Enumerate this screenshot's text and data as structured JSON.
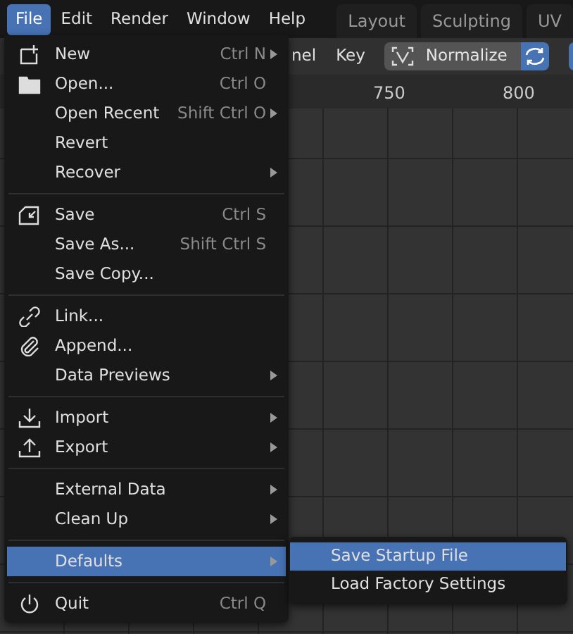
{
  "menubar": [
    {
      "label": "File",
      "selected": true
    },
    {
      "label": "Edit",
      "selected": false
    },
    {
      "label": "Render",
      "selected": false
    },
    {
      "label": "Window",
      "selected": false
    },
    {
      "label": "Help",
      "selected": false
    }
  ],
  "workspace_tabs": [
    {
      "label": "Layout",
      "selected": false
    },
    {
      "label": "Sculpting",
      "selected": false
    },
    {
      "label": "UV",
      "selected": false
    }
  ],
  "header": {
    "items": [
      "nel",
      "Key"
    ],
    "normalize_button": "Normalize"
  },
  "ruler": {
    "ticks": [
      "750",
      "800"
    ]
  },
  "file_menu": {
    "sections": [
      [
        {
          "label": "New",
          "shortcut": "Ctrl N",
          "kind": "new",
          "submenu": true,
          "selected": false
        },
        {
          "label": "Open...",
          "shortcut": "Ctrl O",
          "kind": "open",
          "submenu": false,
          "selected": false
        },
        {
          "label": "Open Recent",
          "shortcut": "Shift Ctrl O",
          "submenu": true,
          "selected": false
        },
        {
          "label": "Revert",
          "submenu": false,
          "selected": false
        },
        {
          "label": "Recover",
          "submenu": true,
          "selected": false
        }
      ],
      [
        {
          "label": "Save",
          "shortcut": "Ctrl S",
          "kind": "save",
          "submenu": false,
          "selected": false
        },
        {
          "label": "Save As...",
          "shortcut": "Shift Ctrl S",
          "submenu": false,
          "selected": false
        },
        {
          "label": "Save Copy...",
          "submenu": false,
          "selected": false
        }
      ],
      [
        {
          "label": "Link...",
          "kind": "link",
          "submenu": false,
          "selected": false
        },
        {
          "label": "Append...",
          "kind": "append",
          "submenu": false,
          "selected": false
        },
        {
          "label": "Data Previews",
          "submenu": true,
          "selected": false
        }
      ],
      [
        {
          "label": "Import",
          "kind": "import",
          "submenu": true,
          "selected": false
        },
        {
          "label": "Export",
          "kind": "export",
          "submenu": true,
          "selected": false
        }
      ],
      [
        {
          "label": "External Data",
          "submenu": true,
          "selected": false
        },
        {
          "label": "Clean Up",
          "submenu": true,
          "selected": false
        }
      ],
      [
        {
          "label": "Defaults",
          "submenu": true,
          "selected": true
        }
      ],
      [
        {
          "label": "Quit",
          "shortcut": "Ctrl Q",
          "kind": "quit",
          "submenu": false,
          "selected": false
        }
      ]
    ]
  },
  "defaults_submenu": [
    {
      "label": "Save Startup File",
      "selected": true
    },
    {
      "label": "Load Factory Settings",
      "selected": false
    }
  ]
}
